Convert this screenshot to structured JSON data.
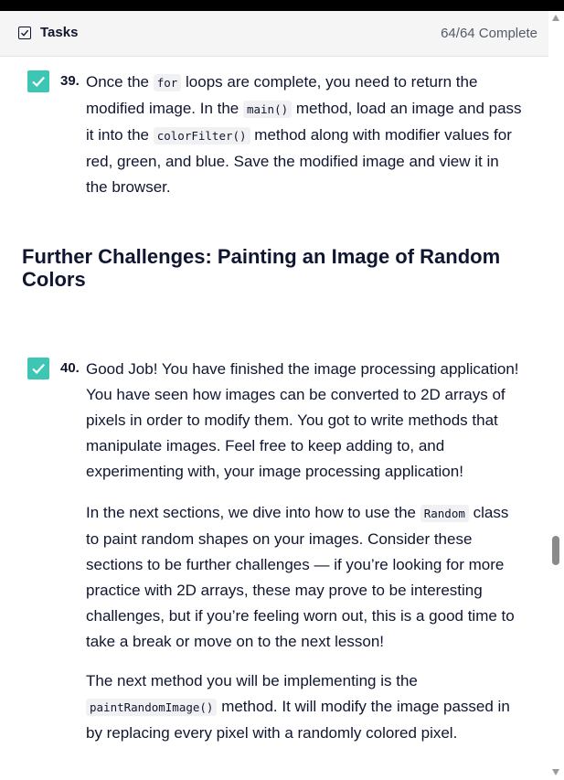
{
  "header": {
    "title": "Tasks",
    "progress": "64/64 Complete"
  },
  "colors": {
    "check": "#3ec6b5",
    "text": "#10162f",
    "code_bg": "#f1f1f3"
  },
  "tasks": [
    {
      "number": "39.",
      "checked": true,
      "paragraphs": [
        {
          "segments": [
            {
              "t": "Once the "
            },
            {
              "c": "for"
            },
            {
              "t": " loops are complete, you need to return the modified image. In the "
            },
            {
              "c": "main()"
            },
            {
              "t": " method, load an image and pass it into the "
            },
            {
              "c": "colorFilter()"
            },
            {
              "t": " method along with modifier values for red, green, and blue. Save the modified image and view it in the browser."
            }
          ]
        }
      ]
    },
    {
      "number": "40.",
      "checked": true,
      "paragraphs": [
        {
          "segments": [
            {
              "t": "Good Job! You have finished the image processing application! You have seen how images can be converted to 2D arrays of pixels in order to modify them. You got to write methods that manipulate images. Feel free to keep adding to, and experimenting with, your image processing application!"
            }
          ]
        },
        {
          "segments": [
            {
              "t": "In the next sections, we dive into how to use the "
            },
            {
              "c": "Random"
            },
            {
              "t": " class to paint random shapes on your images. Consider these sections to be further challenges — if you’re looking for more practice with 2D arrays, these may prove to be interesting challenges, but if you’re feeling worn out, this is a good time to take a break or move on to the next lesson!"
            }
          ]
        },
        {
          "segments": [
            {
              "t": "The next method you will be implementing is the "
            },
            {
              "c": "paintRandomImage()"
            },
            {
              "t": " method. It will modify the image passed in by replacing every pixel with a randomly colored pixel."
            }
          ]
        }
      ]
    }
  ],
  "section_heading": "Further Challenges: Painting an Image of Random Colors"
}
